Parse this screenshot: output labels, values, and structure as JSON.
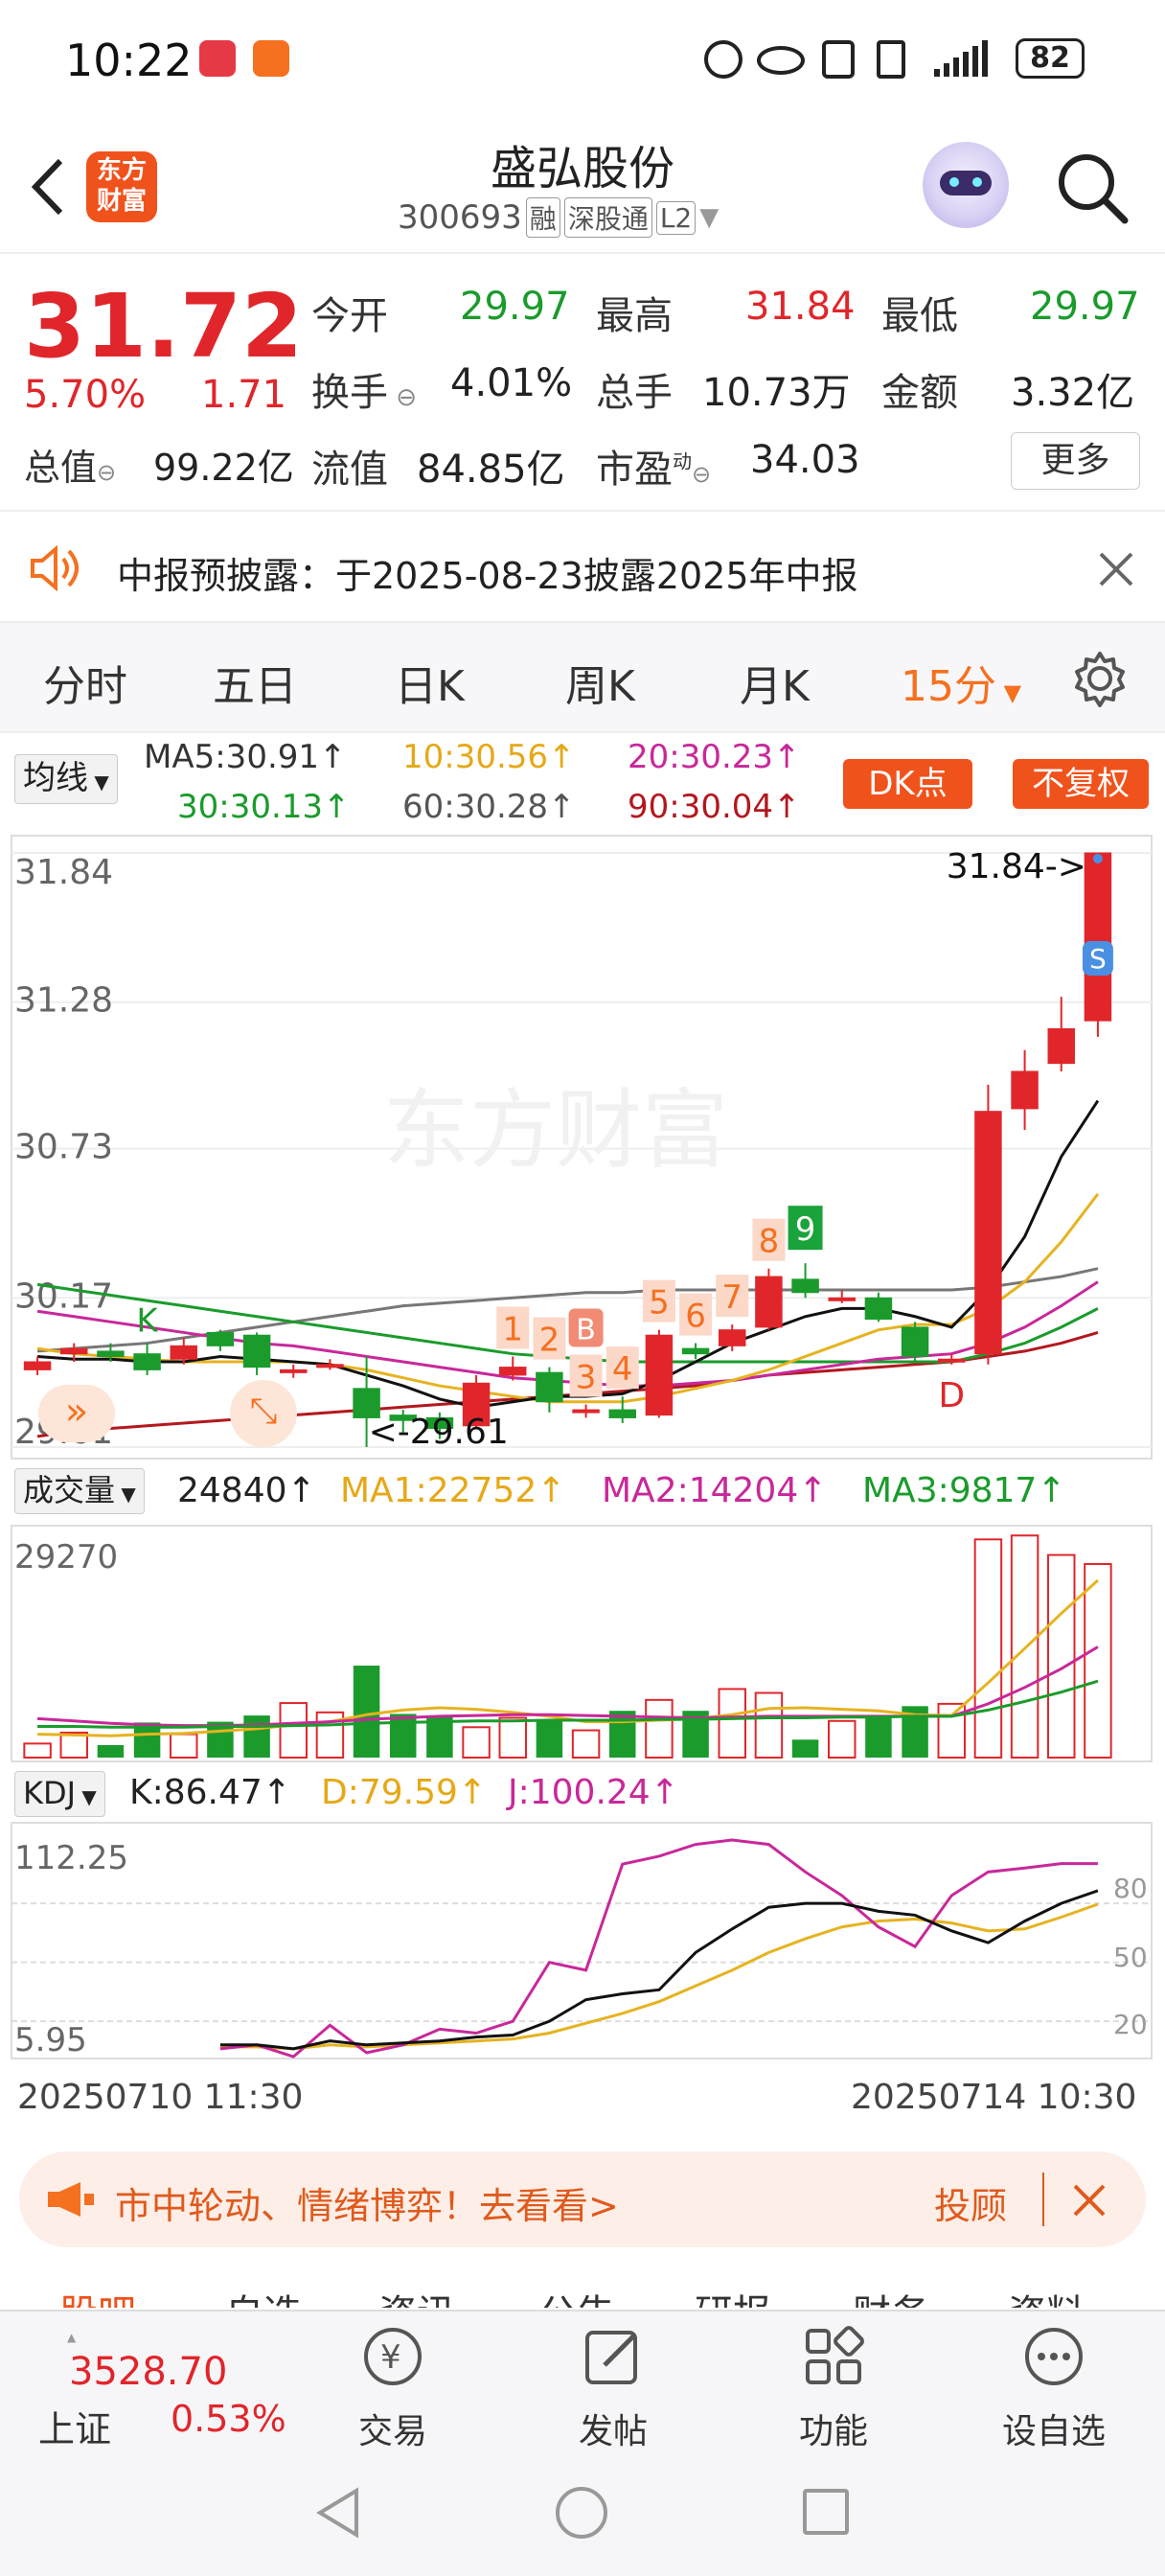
{
  "status_bar": {
    "time": "10:22",
    "battery": "82"
  },
  "header": {
    "title": "盛弘股份",
    "code": "300693",
    "badge_rong": "融",
    "badge_sgt": "深股通",
    "badge_l2": "L2",
    "logo_text_1": "东方",
    "logo_text_2": "财富"
  },
  "quote": {
    "price": "31.72",
    "change_pct": "5.70%",
    "change": "1.71",
    "fields": [
      {
        "label": "今开",
        "value": "29.97"
      },
      {
        "label": "最高",
        "value": "31.84"
      },
      {
        "label": "最低",
        "value": "29.97"
      },
      {
        "label": "换手",
        "value": "4.01%"
      },
      {
        "label": "总手",
        "value": "10.73万"
      },
      {
        "label": "金额",
        "value": "3.32亿"
      },
      {
        "label": "总值",
        "value": "99.22亿"
      },
      {
        "label": "流值",
        "value": "84.85亿"
      },
      {
        "label": "市盈",
        "value": "34.03"
      }
    ],
    "pe_sup": "动",
    "more_button": "更多"
  },
  "notice": {
    "text": "中报预披露：于2025-08-23披露2025年中报"
  },
  "tabs": [
    "分时",
    "五日",
    "日K",
    "周K",
    "月K",
    "15分"
  ],
  "active_tab": "15分",
  "ma_legend": {
    "selector": "均线",
    "ma5": "MA5:30.91↑",
    "ma10": "10:30.56↑",
    "ma20": "20:30.23↑",
    "ma30": "30:30.13↑",
    "ma60": "60:30.28↑",
    "ma90": "90:30.04↑",
    "dk_button": "DK点",
    "fq_button": "不复权"
  },
  "chart_data": [
    {
      "type": "candlestick",
      "y_ticks": [
        "31.84",
        "31.28",
        "30.73",
        "30.17",
        "29.61"
      ],
      "ylim": [
        29.61,
        31.84
      ],
      "high_label": "31.84->",
      "low_label": "<-29.61",
      "candles": [
        {
          "o": 29.9,
          "c": 29.93,
          "h": 29.95,
          "l": 29.88
        },
        {
          "o": 29.96,
          "c": 29.98,
          "h": 30.0,
          "l": 29.93
        },
        {
          "o": 29.97,
          "c": 29.95,
          "h": 30.0,
          "l": 29.93
        },
        {
          "o": 29.96,
          "c": 29.9,
          "h": 30.0,
          "l": 29.88
        },
        {
          "o": 29.94,
          "c": 29.99,
          "h": 30.02,
          "l": 29.92
        },
        {
          "o": 30.04,
          "c": 29.99,
          "h": 30.05,
          "l": 29.97
        },
        {
          "o": 30.03,
          "c": 29.91,
          "h": 30.04,
          "l": 29.88
        },
        {
          "o": 29.9,
          "c": 29.9,
          "h": 29.92,
          "l": 29.87
        },
        {
          "o": 29.92,
          "c": 29.92,
          "h": 29.94,
          "l": 29.9
        },
        {
          "o": 29.83,
          "c": 29.72,
          "h": 29.95,
          "l": 29.61
        },
        {
          "o": 29.73,
          "c": 29.71,
          "h": 29.75,
          "l": 29.66
        },
        {
          "o": 29.72,
          "c": 29.68,
          "h": 29.74,
          "l": 29.64
        },
        {
          "o": 29.69,
          "c": 29.85,
          "h": 29.88,
          "l": 29.68
        },
        {
          "o": 29.88,
          "c": 29.91,
          "h": 29.95,
          "l": 29.86
        },
        {
          "o": 29.89,
          "c": 29.78,
          "h": 29.91,
          "l": 29.74
        },
        {
          "o": 29.75,
          "c": 29.75,
          "h": 29.77,
          "l": 29.72
        },
        {
          "o": 29.75,
          "c": 29.72,
          "h": 29.8,
          "l": 29.7
        },
        {
          "o": 29.73,
          "c": 30.03,
          "h": 30.05,
          "l": 29.72
        },
        {
          "o": 29.98,
          "c": 29.96,
          "h": 30.0,
          "l": 29.94
        },
        {
          "o": 29.99,
          "c": 30.05,
          "h": 30.07,
          "l": 29.97
        },
        {
          "o": 30.06,
          "c": 30.25,
          "h": 30.28,
          "l": 30.05
        },
        {
          "o": 30.24,
          "c": 30.19,
          "h": 30.3,
          "l": 30.17
        },
        {
          "o": 30.17,
          "c": 30.17,
          "h": 30.2,
          "l": 30.15
        },
        {
          "o": 30.17,
          "c": 30.09,
          "h": 30.19,
          "l": 30.08
        },
        {
          "o": 30.06,
          "c": 29.95,
          "h": 30.08,
          "l": 29.93
        },
        {
          "o": 29.94,
          "c": 29.94,
          "h": 29.96,
          "l": 29.92
        },
        {
          "o": 29.96,
          "c": 30.87,
          "h": 30.97,
          "l": 29.92
        },
        {
          "o": 30.88,
          "c": 31.02,
          "h": 31.1,
          "l": 30.8
        },
        {
          "o": 31.05,
          "c": 31.18,
          "h": 31.3,
          "l": 31.02
        },
        {
          "o": 31.21,
          "c": 31.84,
          "h": 31.84,
          "l": 31.15
        }
      ],
      "ma5": [
        29.95,
        29.94,
        29.94,
        29.93,
        29.93,
        29.95,
        29.94,
        29.93,
        29.92,
        29.88,
        29.84,
        29.79,
        29.76,
        29.78,
        29.8,
        29.8,
        29.81,
        29.86,
        29.93,
        30.0,
        30.05,
        30.1,
        30.13,
        30.13,
        30.1,
        30.06,
        30.2,
        30.4,
        30.7,
        30.91
      ],
      "ma10": [
        29.98,
        29.96,
        29.95,
        29.94,
        29.93,
        29.93,
        29.93,
        29.93,
        29.92,
        29.9,
        29.87,
        29.84,
        29.82,
        29.8,
        29.78,
        29.78,
        29.78,
        29.8,
        29.83,
        29.86,
        29.9,
        29.95,
        30.0,
        30.05,
        30.07,
        30.07,
        30.13,
        30.23,
        30.38,
        30.56
      ],
      "ma20": [
        30.12,
        30.1,
        30.08,
        30.06,
        30.04,
        30.02,
        30.0,
        29.99,
        29.97,
        29.95,
        29.93,
        29.91,
        29.89,
        29.87,
        29.86,
        29.85,
        29.84,
        29.84,
        29.85,
        29.86,
        29.88,
        29.9,
        29.92,
        29.94,
        29.95,
        29.96,
        30.0,
        30.06,
        30.14,
        30.23
      ],
      "ma30": [
        30.22,
        30.2,
        30.18,
        30.16,
        30.14,
        30.12,
        30.1,
        30.08,
        30.06,
        30.04,
        30.02,
        30.0,
        29.98,
        29.96,
        29.95,
        29.94,
        29.93,
        29.93,
        29.93,
        29.93,
        29.93,
        29.93,
        29.93,
        29.93,
        29.93,
        29.93,
        29.96,
        30.0,
        30.06,
        30.13
      ],
      "ma60": [
        29.97,
        29.98,
        29.99,
        30.0,
        30.02,
        30.04,
        30.06,
        30.08,
        30.1,
        30.12,
        30.14,
        30.15,
        30.16,
        30.17,
        30.18,
        30.19,
        30.19,
        30.2,
        30.2,
        30.2,
        30.2,
        30.2,
        30.2,
        30.2,
        30.2,
        30.2,
        30.21,
        30.23,
        30.25,
        30.28
      ],
      "ma90": [
        29.65,
        29.67,
        29.68,
        29.69,
        29.7,
        29.71,
        29.72,
        29.73,
        29.74,
        29.75,
        29.76,
        29.77,
        29.78,
        29.79,
        29.8,
        29.81,
        29.82,
        29.83,
        29.84,
        29.86,
        29.88,
        29.89,
        29.9,
        29.91,
        29.92,
        29.93,
        29.95,
        29.97,
        30.0,
        30.04
      ],
      "signals": [
        {
          "i": 3,
          "text": "K",
          "kind": "green"
        },
        {
          "i": 13,
          "text": "1",
          "kind": "seq"
        },
        {
          "i": 14,
          "text": "2",
          "kind": "seq"
        },
        {
          "i": 15,
          "text": "3",
          "kind": "seq"
        },
        {
          "i": 15,
          "text": "B",
          "kind": "buy"
        },
        {
          "i": 16,
          "text": "4",
          "kind": "seq"
        },
        {
          "i": 17,
          "text": "5",
          "kind": "seq"
        },
        {
          "i": 18,
          "text": "6",
          "kind": "seq"
        },
        {
          "i": 19,
          "text": "7",
          "kind": "seq"
        },
        {
          "i": 20,
          "text": "8",
          "kind": "seq"
        },
        {
          "i": 21,
          "text": "9",
          "kind": "nine"
        },
        {
          "i": 25,
          "text": "D",
          "kind": "red"
        },
        {
          "i": 29,
          "text": "S",
          "kind": "sell"
        }
      ]
    },
    {
      "type": "bar",
      "title": "成交量",
      "value_label": "24840↑",
      "ma1": "MA1:22752↑",
      "ma2": "MA2:14204↑",
      "ma3": "MA3:9817↑",
      "y_max_label": "29270",
      "values": [
        1800,
        3200,
        1600,
        4500,
        3000,
        4600,
        5400,
        7000,
        5800,
        11800,
        5600,
        5400,
        3900,
        5100,
        4800,
        3500,
        6000,
        7400,
        6000,
        8800,
        8300,
        2300,
        4700,
        5400,
        6600,
        6900,
        28000,
        28500,
        26000,
        24840
      ],
      "ma1_values": [
        3000,
        2900,
        2800,
        3000,
        3100,
        3400,
        3700,
        4200,
        4600,
        5500,
        6100,
        6400,
        6200,
        5800,
        5300,
        4600,
        4600,
        4800,
        5000,
        5500,
        6300,
        6400,
        6200,
        6000,
        5500,
        5400,
        9600,
        14000,
        18500,
        22752
      ],
      "ma2_values": [
        5000,
        4700,
        4400,
        4200,
        4100,
        4100,
        4200,
        4400,
        4600,
        4900,
        5100,
        5300,
        5400,
        5500,
        5500,
        5400,
        5300,
        5200,
        5100,
        5200,
        5300,
        5300,
        5300,
        5300,
        5300,
        5300,
        6900,
        9000,
        11400,
        14204
      ],
      "ma3_values": [
        4000,
        4000,
        3900,
        3900,
        3900,
        4000,
        4000,
        4100,
        4200,
        4400,
        4500,
        4600,
        4700,
        4700,
        4800,
        4800,
        4800,
        4900,
        4900,
        5000,
        5100,
        5100,
        5200,
        5200,
        5300,
        5300,
        6100,
        7200,
        8400,
        9817
      ]
    },
    {
      "type": "line",
      "title": "KDJ",
      "k_label": "K:86.47↑",
      "d_label": "D:79.59↑",
      "j_label": "J:100.24↑",
      "y_top_label": "112.25",
      "y_bottom_label": "5.95",
      "ylim": [
        5.95,
        112.25
      ],
      "levels": [
        "80",
        "50",
        "20"
      ],
      "k": [
        8,
        8,
        6,
        10,
        8,
        9,
        10,
        12,
        13,
        20,
        31,
        34,
        36,
        55,
        67,
        78,
        80,
        80,
        76,
        74,
        66,
        60,
        71,
        80,
        86.47
      ],
      "d": [
        7,
        7,
        6,
        8,
        7,
        8,
        9,
        10,
        11,
        14,
        19,
        24,
        30,
        38,
        46,
        55,
        62,
        68,
        71,
        72,
        70,
        66,
        67,
        73,
        79.59
      ],
      "j": [
        6,
        8,
        2,
        18,
        4,
        8,
        16,
        14,
        20,
        50,
        46,
        100,
        104,
        110,
        114,
        110,
        96,
        84,
        68,
        58,
        84,
        96,
        98,
        100.24,
        100.24
      ],
      "x_start": "20250710 11:30",
      "x_end": "20250714 10:30"
    }
  ],
  "ad_banner": {
    "text": "市中轮动、情绪博弈！去看看>",
    "right": "投顾"
  },
  "bottom_tabs": [
    "股吧",
    "自选",
    "资讯",
    "公告",
    "研报",
    "财务",
    "资料"
  ],
  "tabbar": {
    "index_value": "3528.70",
    "index_name": "上证",
    "index_pct": "0.53%",
    "items": [
      {
        "label": "交易",
        "icon": "yen-cycle-icon"
      },
      {
        "label": "发帖",
        "icon": "edit-icon"
      },
      {
        "label": "功能",
        "icon": "grid-icon"
      },
      {
        "label": "设自选",
        "icon": "more-icon"
      }
    ]
  },
  "colors": {
    "up": "#e0262b",
    "down": "#1a9b2c",
    "accent": "#f5701f"
  }
}
